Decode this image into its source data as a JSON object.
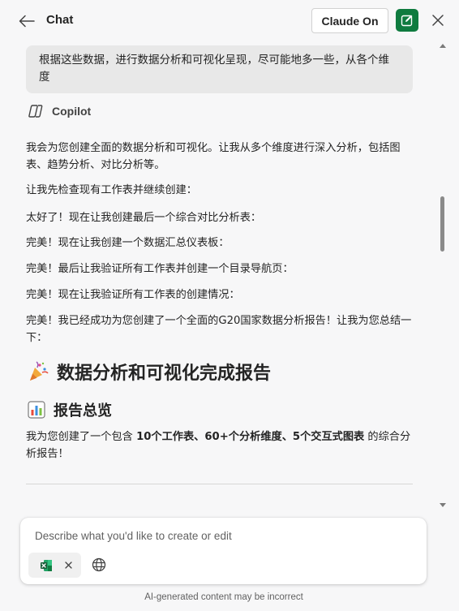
{
  "header": {
    "title": "Chat",
    "claude_button_label": "Claude On"
  },
  "conversation": {
    "user_message": "根据这些数据，进行数据分析和可视化呈现，尽可能地多一些，从各个维度",
    "assistant_name": "Copilot",
    "paragraphs": [
      "我会为您创建全面的数据分析和可视化。让我从多个维度进行深入分析，包括图表、趋势分析、对比分析等。",
      "让我先检查现有工作表并继续创建：",
      "太好了！现在让我创建最后一个综合对比分析表：",
      "完美！现在让我创建一个数据汇总仪表板：",
      "完美！最后让我验证所有工作表并创建一个目录导航页：",
      "完美！现在让我验证所有工作表的创建情况：",
      "完美！我已经成功为您创建了一个全面的G20国家数据分析报告！让我为您总结一下："
    ],
    "heading_1": "数据分析和可视化完成报告",
    "heading_2": "报告总览",
    "summary": {
      "prefix": "我为您创建了一个包含 ",
      "bold": "10个工作表、60+个分析维度、5个交互式图表",
      "suffix": " 的综合分析报告！"
    }
  },
  "composer": {
    "placeholder": "Describe what you'd like to create or edit"
  },
  "footer": {
    "note": "AI-generated content may be incorrect"
  },
  "icons": {
    "back": "arrow-left-icon",
    "new_chat": "compose-icon",
    "close": "close-icon",
    "copilot": "copilot-icon",
    "party": "party-popper-icon",
    "chart": "bar-chart-icon",
    "excel": "excel-icon",
    "remove": "close-icon",
    "web": "globe-icon"
  },
  "colors": {
    "accent_green": "#0f7b3f",
    "bubble_bg": "#e8e8e8",
    "page_bg": "#f7f7f8"
  }
}
